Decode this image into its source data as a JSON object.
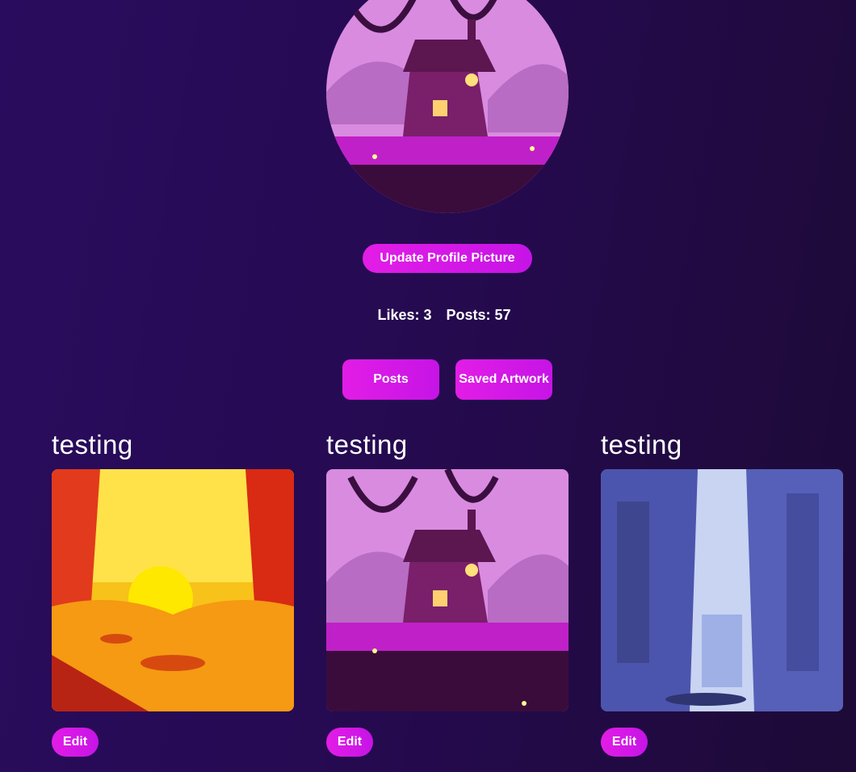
{
  "profile": {
    "update_label": "Update Profile Picture",
    "likes_label": "Likes: 3",
    "posts_label": "Posts: 57"
  },
  "tabs": {
    "posts_label": "Posts",
    "saved_label": "Saved Artwork"
  },
  "posts": [
    {
      "title": "testing",
      "edit_label": "Edit"
    },
    {
      "title": "testing",
      "edit_label": "Edit"
    },
    {
      "title": "testing",
      "edit_label": "Edit"
    }
  ],
  "colors": {
    "accent": "#d91ae6",
    "background": "#260a52"
  }
}
